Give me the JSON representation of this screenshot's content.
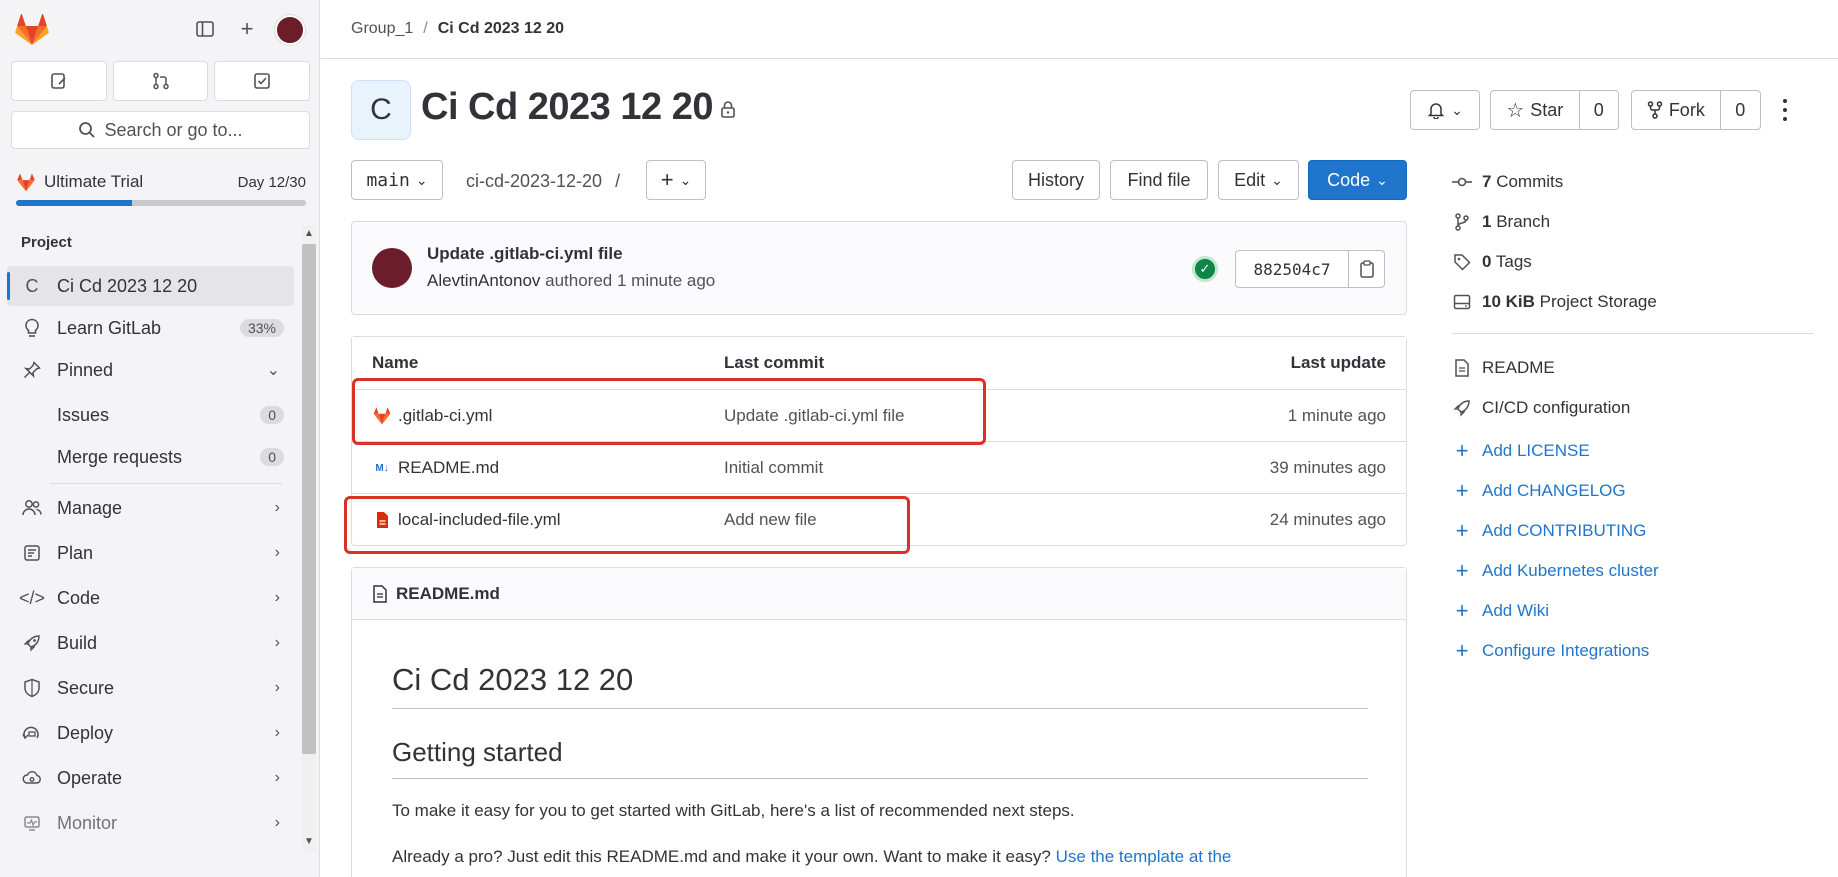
{
  "sidebar": {
    "search_placeholder": "Search or go to...",
    "trial": {
      "label": "Ultimate Trial",
      "day": "Day 12/30",
      "progress_fraction": 0.4
    },
    "section_title": "Project",
    "items": [
      {
        "label": "Ci Cd 2023 12 20",
        "icon_letter": "C"
      },
      {
        "label": "Learn GitLab",
        "badge": "33%"
      },
      {
        "label": "Pinned"
      },
      {
        "label": "Issues",
        "badge": "0"
      },
      {
        "label": "Merge requests",
        "badge": "0"
      },
      {
        "label": "Manage"
      },
      {
        "label": "Plan"
      },
      {
        "label": "Code"
      },
      {
        "label": "Build"
      },
      {
        "label": "Secure"
      },
      {
        "label": "Deploy"
      },
      {
        "label": "Operate"
      },
      {
        "label": "Monitor"
      }
    ]
  },
  "breadcrumb": {
    "group": "Group_1",
    "separator": "/",
    "project": "Ci Cd 2023 12 20"
  },
  "project": {
    "avatar_letter": "C",
    "title": "Ci Cd 2023 12 20"
  },
  "actions": {
    "star_label": "Star",
    "star_count": "0",
    "fork_label": "Fork",
    "fork_count": "0"
  },
  "toolbar": {
    "branch": "main",
    "path": "ci-cd-2023-12-20",
    "path_sep": "/",
    "history": "History",
    "find_file": "Find file",
    "edit": "Edit",
    "code": "Code"
  },
  "last_commit": {
    "title": "Update .gitlab-ci.yml file",
    "author": "AlevtinAntonov",
    "meta_rest": "authored 1 minute ago",
    "sha": "882504c7"
  },
  "file_table": {
    "headers": {
      "name": "Name",
      "last_commit": "Last commit",
      "last_update": "Last update"
    },
    "rows": [
      {
        "name": ".gitlab-ci.yml",
        "commit": "Update .gitlab-ci.yml file",
        "date": "1 minute ago",
        "icon": "gitlab-icon"
      },
      {
        "name": "README.md",
        "commit": "Initial commit",
        "date": "39 minutes ago",
        "icon": "markdown-icon"
      },
      {
        "name": "local-included-file.yml",
        "commit": "Add new file",
        "date": "24 minutes ago",
        "icon": "file-icon"
      }
    ]
  },
  "readme": {
    "file_name": "README.md",
    "h1": "Ci Cd 2023 12 20",
    "h2": "Getting started",
    "p1": "To make it easy for you to get started with GitLab, here's a list of recommended next steps.",
    "p2": "Already a pro? Just edit this README.md and make it your own. Want to make it easy?",
    "p2_link": "Use the template at the"
  },
  "stats": [
    {
      "count": "7",
      "label": "Commits"
    },
    {
      "count": "1",
      "label": "Branch"
    },
    {
      "count": "0",
      "label": "Tags"
    },
    {
      "count": "10 KiB",
      "label": "Project Storage"
    }
  ],
  "side_links": {
    "readme": "README",
    "cicd": "CI/CD configuration",
    "add": [
      "Add LICENSE",
      "Add CHANGELOG",
      "Add CONTRIBUTING",
      "Add Kubernetes cluster",
      "Add Wiki",
      "Configure Integrations"
    ]
  },
  "colors": {
    "accent": "#1f75cb",
    "highlight": "#d8312a",
    "success": "#108548"
  }
}
